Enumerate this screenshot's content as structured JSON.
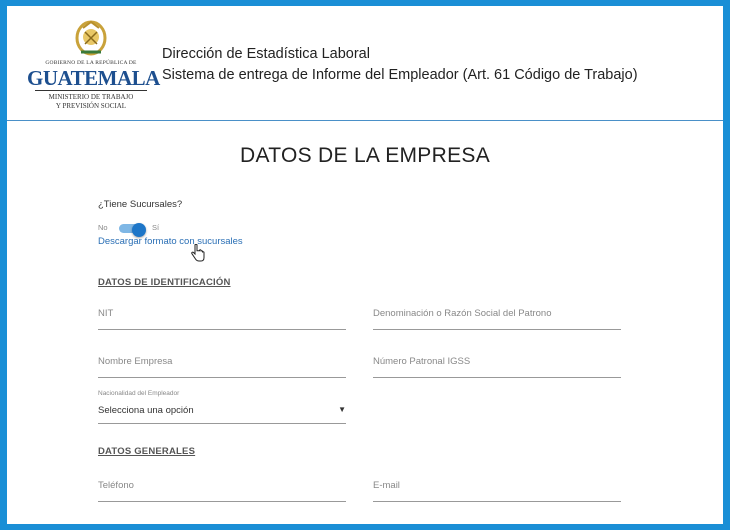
{
  "header": {
    "logo": {
      "government_line": "GOBIERNO DE LA REPÚBLICA DE",
      "country": "GUATEMALA",
      "ministry_line1": "MINISTERIO DE TRABAJO",
      "ministry_line2": "Y PREVISIÓN SOCIAL"
    },
    "title_line1": "Dirección de Estadística Laboral",
    "title_line2": "Sistema de entrega de Informe del Empleador (Art. 61 Código de Trabajo)"
  },
  "page_title": "DATOS DE LA EMPRESA",
  "branches": {
    "question": "¿Tiene Sucursales?",
    "toggle_off_label": "No",
    "toggle_on_label": "Sí",
    "toggle_state": "on",
    "download_link": "Descargar formato con sucursales"
  },
  "identification": {
    "section_title": "DATOS DE IDENTIFICACIÓN",
    "nit_placeholder": "NIT",
    "razon_social_placeholder": "Denominación o Razón Social del Patrono",
    "nombre_empresa_placeholder": "Nombre Empresa",
    "numero_patronal_placeholder": "Número Patronal IGSS",
    "nacionalidad_label": "Nacionalidad del Empleador",
    "nacionalidad_value": "Selecciona una opción"
  },
  "general": {
    "section_title": "DATOS GENERALES",
    "telefono_placeholder": "Teléfono",
    "email_placeholder": "E-mail"
  },
  "colors": {
    "page_border": "#1a8fd6",
    "accent": "#1d76c8",
    "link": "#2a6fb5",
    "logo_text": "#1d4f8f"
  }
}
